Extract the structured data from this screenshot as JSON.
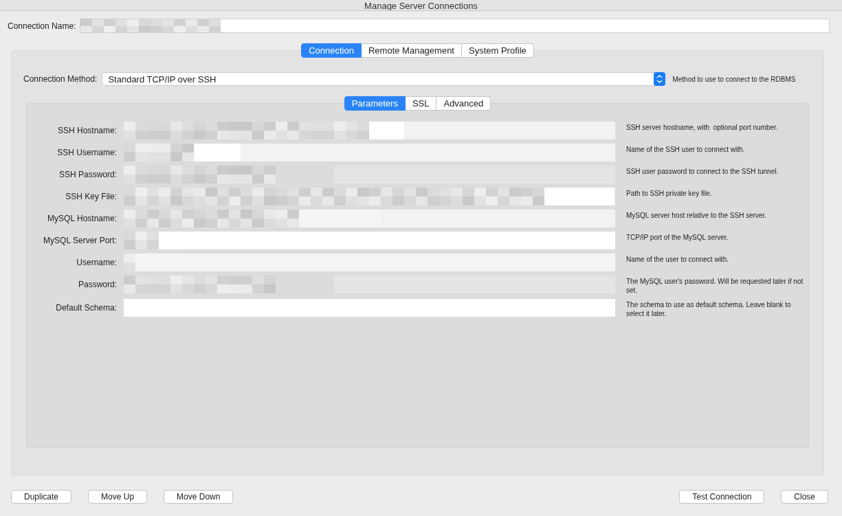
{
  "window": {
    "title": "Manage Server Connections"
  },
  "connection_name": {
    "label": "Connection Name:"
  },
  "tabs": [
    {
      "label": "Connection",
      "selected": true
    },
    {
      "label": "Remote Management",
      "selected": false
    },
    {
      "label": "System Profile",
      "selected": false
    }
  ],
  "connection_method": {
    "label": "Connection Method:",
    "value": "Standard TCP/IP over SSH",
    "hint": "Method to use to connect to the RDBMS"
  },
  "subtabs": [
    {
      "label": "Parameters",
      "selected": true
    },
    {
      "label": "SSL",
      "selected": false
    },
    {
      "label": "Advanced",
      "selected": false
    }
  ],
  "parameters": [
    {
      "label": "SSH Hostname:",
      "hint": "SSH server hostname, with  optional port number."
    },
    {
      "label": "SSH Username:",
      "hint": "Name of the SSH user to connect with."
    },
    {
      "label": "SSH Password:",
      "hint": "SSH user password to connect to the SSH tunnel."
    },
    {
      "label": "SSH Key File:",
      "hint": "Path to SSH private key file."
    },
    {
      "label": "MySQL Hostname:",
      "hint": "MySQL server host relative to the SSH server."
    },
    {
      "label": "MySQL Server Port:",
      "hint": "TCP/IP port of the MySQL server."
    },
    {
      "label": "Username:",
      "hint": "Name of the user to connect with."
    },
    {
      "label": "Password:",
      "hint": "The MySQL user's password. Will be requested later if not set."
    },
    {
      "label": "Default Schema:",
      "hint": "The schema to use as default schema. Leave blank to select it later."
    }
  ],
  "buttons_left": [
    "Duplicate",
    "Move Up",
    "Move Down"
  ],
  "buttons_right": [
    "Test Connection",
    "Close"
  ]
}
